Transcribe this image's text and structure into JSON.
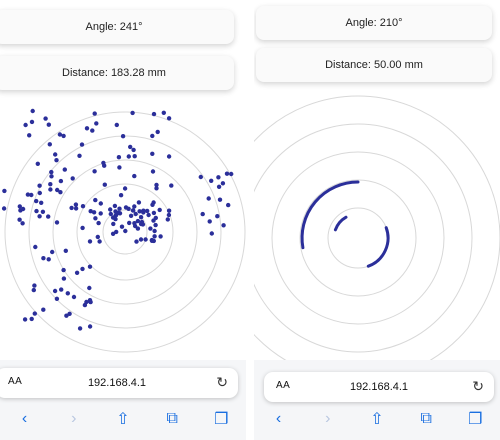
{
  "left": {
    "angle_label": "Angle: 241°",
    "distance_label": "Distance: 183.28 mm",
    "address": "192.168.4.1",
    "aa": "AA"
  },
  "right": {
    "angle_label": "Angle: 210°",
    "distance_label": "Distance: 50.00 mm",
    "address": "192.168.4.1",
    "aa": "AA"
  },
  "icons": {
    "reload": "reload-icon",
    "back": "back-icon",
    "forward": "forward-icon",
    "share": "share-icon",
    "bookmarks": "bookmarks-icon",
    "tabs": "tabs-icon"
  },
  "colors": {
    "point": "#2b2f9a",
    "ring": "#d8d8d8",
    "link": "#1a6fe0"
  }
}
